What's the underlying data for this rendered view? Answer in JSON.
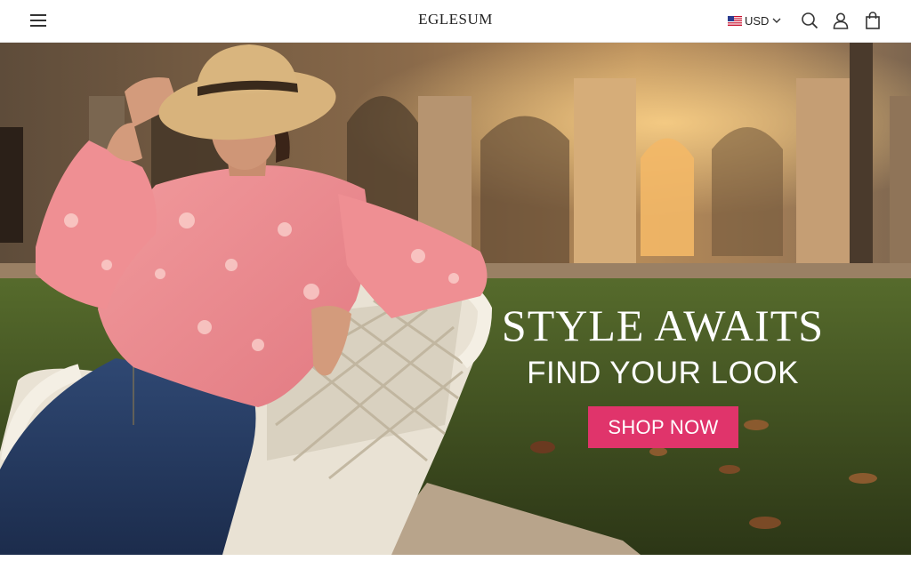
{
  "header": {
    "brand": "EGLESUM",
    "currency": {
      "flag_icon": "us-flag-icon",
      "label": "USD"
    },
    "icons": [
      "hamburger-menu-icon",
      "search-icon",
      "account-icon",
      "shopping-bag-icon"
    ]
  },
  "hero": {
    "title": "STYLE AWAITS",
    "subtitle": "FIND YOUR LOOK",
    "cta_label": "SHOP NOW",
    "image_alt": "Woman in a pink floral blouse, straw hat and jeans seated on a white wicker chair in a sunlit arcaded courtyard"
  },
  "colors": {
    "accent": "#e0346b",
    "header_bg": "#ffffff",
    "text": "#222222"
  }
}
